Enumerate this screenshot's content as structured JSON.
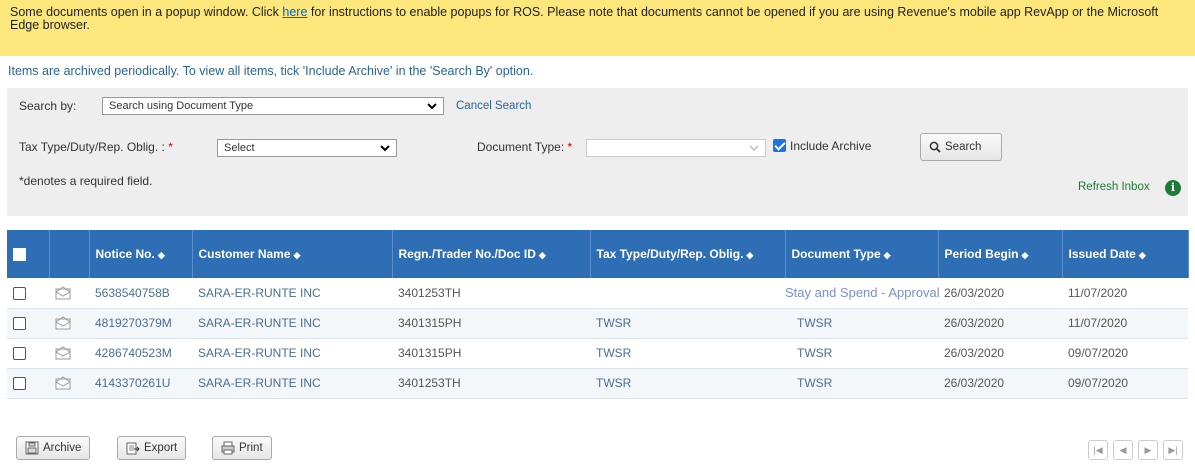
{
  "notice": {
    "text_before": "Some documents open in a popup window. Click ",
    "link": "here",
    "text_after": " for instructions to enable popups for ROS. Please note that documents cannot be opened if you are using Revenue's mobile app RevApp or the Microsoft Edge browser."
  },
  "archive_message": "Items are archived periodically. To view all items, tick 'Include Archive' in the 'Search By' option.",
  "search": {
    "search_by_label": "Search by:",
    "search_by_value": "Search using Document Type",
    "cancel_search": "Cancel Search",
    "tax_type_label": "Tax Type/Duty/Rep. Oblig. :",
    "tax_type_value": "Select",
    "document_type_label": "Document Type:",
    "document_type_value": "",
    "required_mark": "*",
    "include_archive_label": "Include Archive",
    "include_archive_checked": true,
    "search_button": "Search",
    "required_note": "*denotes a required field.",
    "refresh_inbox": "Refresh Inbox"
  },
  "table": {
    "headers": [
      "Notice No.",
      "Customer Name",
      "Regn./Trader No./Doc ID",
      "Tax Type/Duty/Rep. Oblig.",
      "Document Type",
      "Period Begin",
      "Issued Date"
    ],
    "sort_glyph": "◆",
    "rows": [
      {
        "notice_no": "5638540758B",
        "customer": "SARA-ER-RUNTE INC",
        "regn": "3401253TH",
        "tax_type": "",
        "doc_type": "Stay and Spend - Approval",
        "period_begin": "26/03/2020",
        "issued": "11/07/2020"
      },
      {
        "notice_no": "4819270379M",
        "customer": "SARA-ER-RUNTE INC",
        "regn": "3401315PH",
        "tax_type": "TWSR",
        "doc_type": "TWSR",
        "period_begin": "26/03/2020",
        "issued": "11/07/2020"
      },
      {
        "notice_no": "4286740523M",
        "customer": "SARA-ER-RUNTE INC",
        "regn": "3401315PH",
        "tax_type": "TWSR",
        "doc_type": "TWSR",
        "period_begin": "26/03/2020",
        "issued": "09/07/2020"
      },
      {
        "notice_no": "4143370261U",
        "customer": "SARA-ER-RUNTE INC",
        "regn": "3401253TH",
        "tax_type": "TWSR",
        "doc_type": "TWSR",
        "period_begin": "26/03/2020",
        "issued": "09/07/2020"
      }
    ]
  },
  "footer": {
    "archive_button": "Archive",
    "export_button": "Export",
    "print_button": "Print"
  },
  "colors": {
    "notice_bg": "#fce77d",
    "header_bg": "#2e6eb5",
    "panel_bg": "#eeeeee",
    "link": "#2a6496"
  },
  "icons": {
    "envelope": "envelope-icon",
    "search": "search-icon",
    "info": "info-icon",
    "archive": "archive-icon",
    "export": "export-icon",
    "print": "print-icon"
  }
}
